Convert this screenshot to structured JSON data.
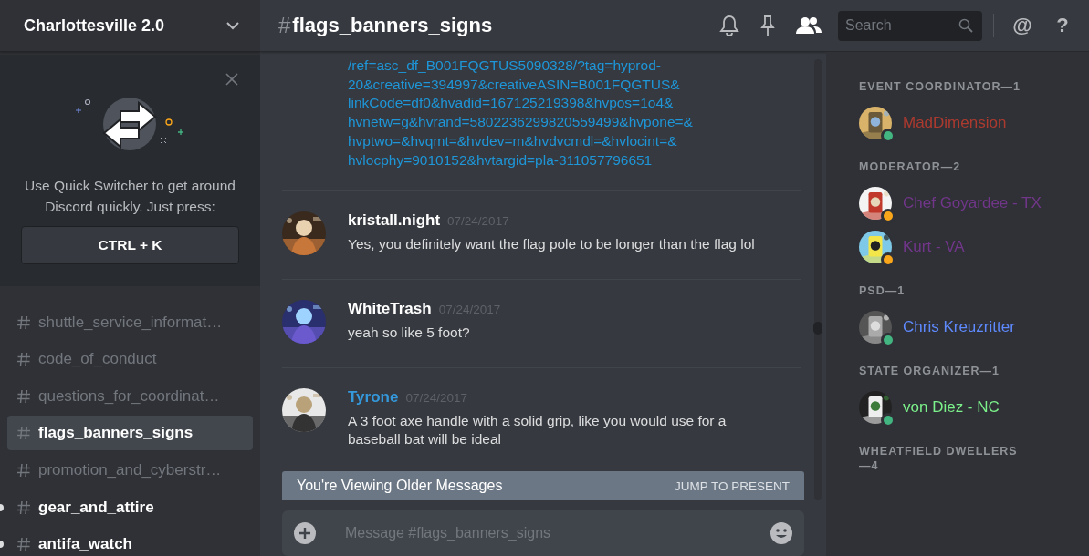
{
  "server": {
    "name": "Charlottesville 2.0"
  },
  "quick_switcher": {
    "text": "Use Quick Switcher to get around Discord quickly. Just press:",
    "shortcut": "CTRL + K"
  },
  "channels": [
    {
      "name": "shuttle_service_informat…",
      "selected": false,
      "unread": false
    },
    {
      "name": "code_of_conduct",
      "selected": false,
      "unread": false
    },
    {
      "name": "questions_for_coordinat…",
      "selected": false,
      "unread": false
    },
    {
      "name": "flags_banners_signs",
      "selected": true,
      "unread": false
    },
    {
      "name": "promotion_and_cyberstr…",
      "selected": false,
      "unread": false
    },
    {
      "name": "gear_and_attire",
      "selected": false,
      "unread": true
    },
    {
      "name": "antifa_watch",
      "selected": false,
      "unread": true
    }
  ],
  "header": {
    "hash": "#",
    "channel": "flags_banners_signs",
    "search_placeholder": "Search",
    "at": "@",
    "help": "?"
  },
  "link_lines": [
    "/ref=asc_df_B001FQGTUS5090328/?tag=hyprod-",
    "20&creative=394997&creativeASIN=B001FQGTUS&",
    "linkCode=df0&hvadid=167125219398&hvpos=1o4&",
    "hvnetw=g&hvrand=5802236299820559499&hvpone=&",
    "hvptwo=&hvqmt=&hvdev=m&hvdvcmdl=&hvlocint=&",
    "hvlocphy=9010152&hvtargid=pla-311057796651"
  ],
  "messages": [
    {
      "author": "kristall.night",
      "color": "#ffffff",
      "time": "07/24/2017",
      "text": "Yes, you definitely want the flag pole to be longer than the flag lol"
    },
    {
      "author": "WhiteTrash",
      "color": "#ffffff",
      "time": "07/24/2017",
      "text": "yeah so like 5 foot?"
    },
    {
      "author": "Tyrone",
      "color": "#3498db",
      "time": "07/24/2017",
      "text": "A 3 foot axe handle with a solid grip, like you would use for a baseball bat will be ideal"
    }
  ],
  "older_bar": {
    "text": "You're Viewing Older Messages",
    "action": "JUMP TO PRESENT"
  },
  "composer": {
    "placeholder": "Message #flags_banners_signs"
  },
  "member_groups": [
    {
      "title": "EVENT COORDINATOR—1",
      "members": [
        {
          "name": "MadDimension",
          "color": "#ad3a2f",
          "idle": false
        }
      ]
    },
    {
      "title": "MODERATOR—2",
      "members": [
        {
          "name": "Chef Goyardee - TX",
          "color": "#71368a",
          "idle": true
        },
        {
          "name": "Kurt - VA",
          "color": "#71368a",
          "idle": true
        }
      ]
    },
    {
      "title": "PSD—1",
      "members": [
        {
          "name": "Chris Kreuzritter",
          "color": "#5f8aff",
          "idle": false
        }
      ]
    },
    {
      "title": "STATE ORGANIZER—1",
      "members": [
        {
          "name": "von Diez - NC",
          "color": "#7cf08a",
          "idle": false
        }
      ]
    },
    {
      "title": "WHEATFIELD DWELLERS—4"
    }
  ]
}
